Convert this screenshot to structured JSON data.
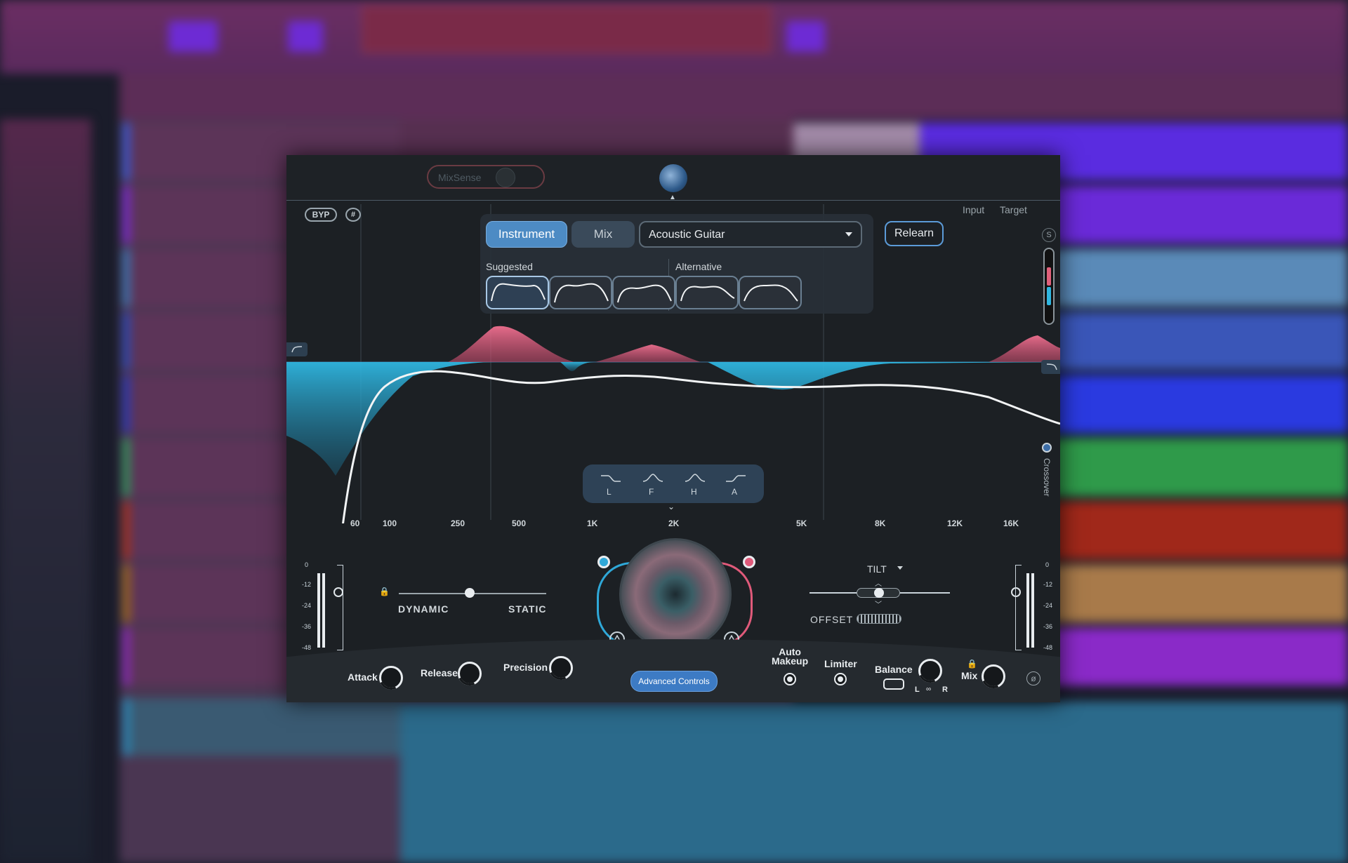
{
  "plugin": {
    "mixsense_label": "MixSense",
    "byp_label": "BYP",
    "grid_label": "#",
    "input_label": "Input",
    "target_label": "Target",
    "s_label": "S",
    "tabs": [
      {
        "label": "Instrument",
        "active": true
      },
      {
        "label": "Mix",
        "active": false
      }
    ],
    "instrument_select": "Acoustic Guitar",
    "suggested_label": "Suggested",
    "alternative_label": "Alternative",
    "relearn_label": "Relearn",
    "crossover_label": "Crossover",
    "filter_buttons": [
      "L",
      "F",
      "H",
      "A"
    ],
    "freq_labels": [
      "60",
      "100",
      "250",
      "500",
      "1K",
      "2K",
      "5K",
      "8K",
      "12K",
      "16K"
    ],
    "meter_scale": [
      "0",
      "-12",
      "-24",
      "-36",
      "-48"
    ],
    "dynamic_label": "DYNAMIC",
    "static_label": "STATIC",
    "tilt_label": "TILT",
    "offset_label": "OFFSET",
    "controls": {
      "attack": "Attack",
      "release": "Release",
      "precision": "Precision",
      "advanced": "Advanced Controls",
      "auto_makeup_1": "Auto",
      "auto_makeup_2": "Makeup",
      "limiter": "Limiter",
      "balance": "Balance",
      "mix": "Mix",
      "balance_l": "L",
      "balance_r": "R",
      "phase": "ø"
    },
    "colors": {
      "accent": "#4d8bc4",
      "cut": "#2fb6e0",
      "boost": "#e0607a"
    }
  }
}
